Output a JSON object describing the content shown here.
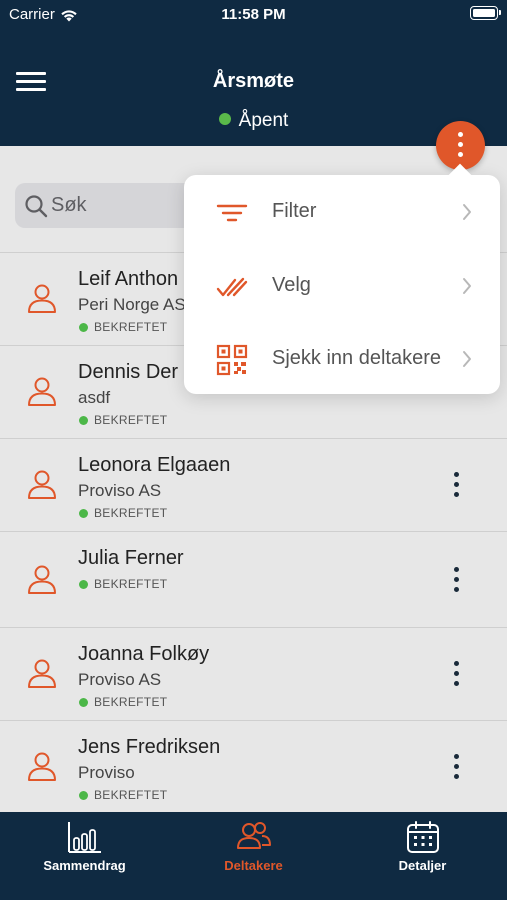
{
  "status_bar": {
    "carrier": "Carrier",
    "time": "11:58 PM"
  },
  "header": {
    "title": "Årsmøte",
    "status": "Åpent",
    "status_color": "#5ab94a"
  },
  "search": {
    "placeholder": "Søk"
  },
  "accent_color": "#e0572a",
  "participants": [
    {
      "name": "Leif Anthon",
      "org": "Peri Norge AS",
      "status": "BEKREFTET"
    },
    {
      "name": "Dennis Der",
      "org": "asdf",
      "status": "BEKREFTET"
    },
    {
      "name": "Leonora Elgaaen",
      "org": "Proviso AS",
      "status": "BEKREFTET"
    },
    {
      "name": "Julia Ferner",
      "org": "",
      "status": "BEKREFTET"
    },
    {
      "name": "Joanna Folkøy",
      "org": "Proviso AS",
      "status": "BEKREFTET"
    },
    {
      "name": "Jens Fredriksen",
      "org": "Proviso",
      "status": "BEKREFTET"
    }
  ],
  "menu": {
    "items": [
      {
        "label": "Filter",
        "icon": "filter-icon"
      },
      {
        "label": "Velg",
        "icon": "double-check-icon"
      },
      {
        "label": "Sjekk inn deltakere",
        "icon": "qr-code-icon"
      }
    ]
  },
  "tabs": [
    {
      "label": "Sammendrag",
      "icon": "bar-chart-icon",
      "active": false
    },
    {
      "label": "Deltakere",
      "icon": "people-icon",
      "active": true
    },
    {
      "label": "Detaljer",
      "icon": "calendar-icon",
      "active": false
    }
  ]
}
